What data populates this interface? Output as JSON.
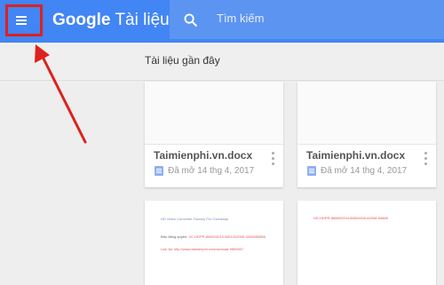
{
  "appbar": {
    "brand": "Google",
    "product": "Tài liệu",
    "search_placeholder": "Tìm kiếm",
    "accent": "#4285f4"
  },
  "section_title": "Tài liệu gần đây",
  "cards": [
    {
      "title": "Taimienphi.vn.docx",
      "meta": "Đã mở 14 thg 4, 2017",
      "icon": "doc-icon"
    },
    {
      "title": "Taimienphi.vn.docx",
      "meta": "Đã mở 14 thg 4, 2017",
      "icon": "doc-icon"
    }
  ],
  "previews": {
    "left": {
      "line1": "HD Video Converter Factory Pro Giveaway",
      "line2_label": "Bản đăng quyền:",
      "line2_value": "VC-HDPR-898024010-8811202006-4345850866",
      "line3": "Link tải: http://www.taimienphi.vn/download-9899807"
    },
    "right": {
      "line1": "HD-HDPR-888802094-88804456-84938-84888"
    }
  },
  "annotation": {
    "color": "#e0201c"
  }
}
